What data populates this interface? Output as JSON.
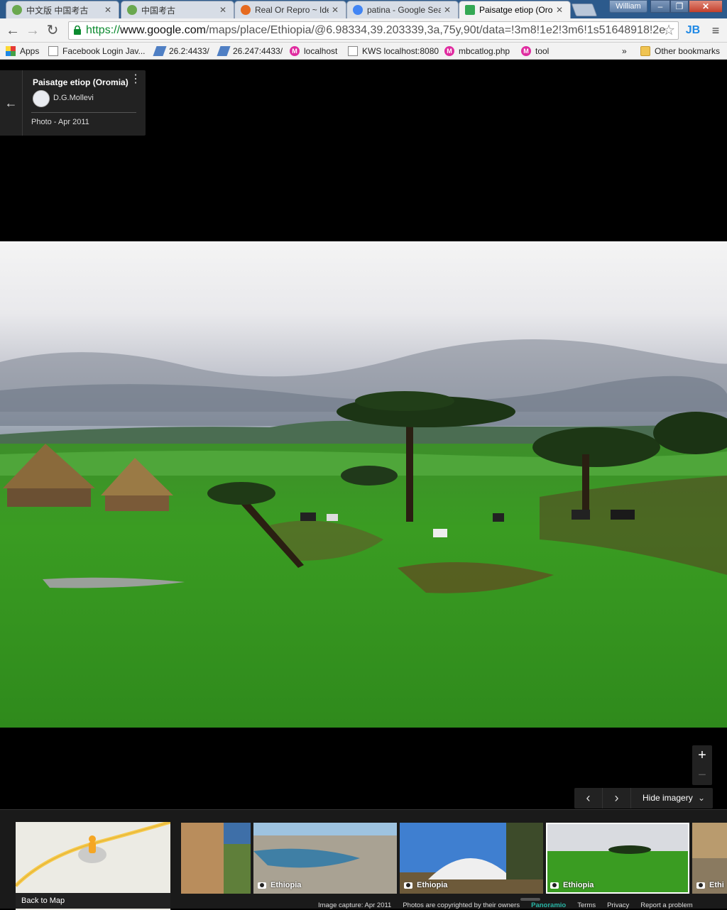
{
  "browser": {
    "tabs": [
      {
        "title": "中文版 中国考古",
        "favicon_color": "#6aa84f",
        "active": false
      },
      {
        "title": "中国考古",
        "favicon_color": "#6aa84f",
        "active": false
      },
      {
        "title": "Real Or Repro ~ Ide",
        "favicon_color": "#e66a1f",
        "active": false
      },
      {
        "title": "patina - Google Sea",
        "favicon_color": "#4285f4",
        "active": false
      },
      {
        "title": "Paisatge etiop (Oro",
        "favicon_color": "#34a853",
        "active": true
      }
    ],
    "user_name": "William",
    "window_buttons": {
      "minimize": "–",
      "maximize": "❐",
      "close": "✕"
    },
    "nav": {
      "back": "←",
      "forward": "→",
      "reload": "↻"
    },
    "url": {
      "scheme": "https://",
      "host": "www.google.com",
      "path": "/maps/place/Ethiopia/@6.98334,39.203339,3a,75y,90t/data=!3m8!1e2!3m6!1s51648918!2e"
    },
    "bookmark_star": "☆",
    "extension_label": "JB",
    "menu_glyph": "≡",
    "bookmarks": [
      {
        "label": "Apps",
        "icon": "apps-icon"
      },
      {
        "label": "Facebook Login Jav...",
        "icon": "page-icon"
      },
      {
        "label": "26.2:4433/",
        "icon": "network-icon"
      },
      {
        "label": "26.247:4433/",
        "icon": "network-icon"
      },
      {
        "label": "localhost",
        "icon": "m-icon"
      },
      {
        "label": "KWS localhost:8080",
        "icon": "page-icon"
      },
      {
        "label": "mbcatlog.php",
        "icon": "m-icon"
      },
      {
        "label": "tool",
        "icon": "m-icon"
      }
    ],
    "bookmarks_overflow": "»",
    "other_bookmarks": "Other bookmarks"
  },
  "maps": {
    "info_card": {
      "back_glyph": "←",
      "title": "Paisatge etiop (Oromia)",
      "author": "D.G.Mollevi",
      "date": "Photo - Apr 2011",
      "menu_glyph": "⋮"
    },
    "zoom": {
      "in": "+",
      "out": "−"
    },
    "imagery_bar": {
      "prev": "‹",
      "next": "›",
      "hide_label": "Hide imagery",
      "hide_glyph": "⌄"
    },
    "back_to_map": "Back to Map",
    "thumbnails": [
      {
        "label": ""
      },
      {
        "label": "Ethiopia"
      },
      {
        "label": "Ethiopia"
      },
      {
        "label": "Ethiopia",
        "selected": true
      },
      {
        "label": "Ethi"
      }
    ],
    "footer": {
      "capture": "Image capture: Apr 2011",
      "copyright": "Photos are copyrighted by their owners",
      "panoramio": "Panoramio",
      "terms": "Terms",
      "privacy": "Privacy",
      "report": "Report a problem"
    }
  },
  "colors": {
    "chrome_tabstrip": "#2c5a8c",
    "page_bg": "#000000",
    "panel_bg": "#222222",
    "url_scheme": "#0b8a2f",
    "panoramio": "#27b5a5"
  }
}
